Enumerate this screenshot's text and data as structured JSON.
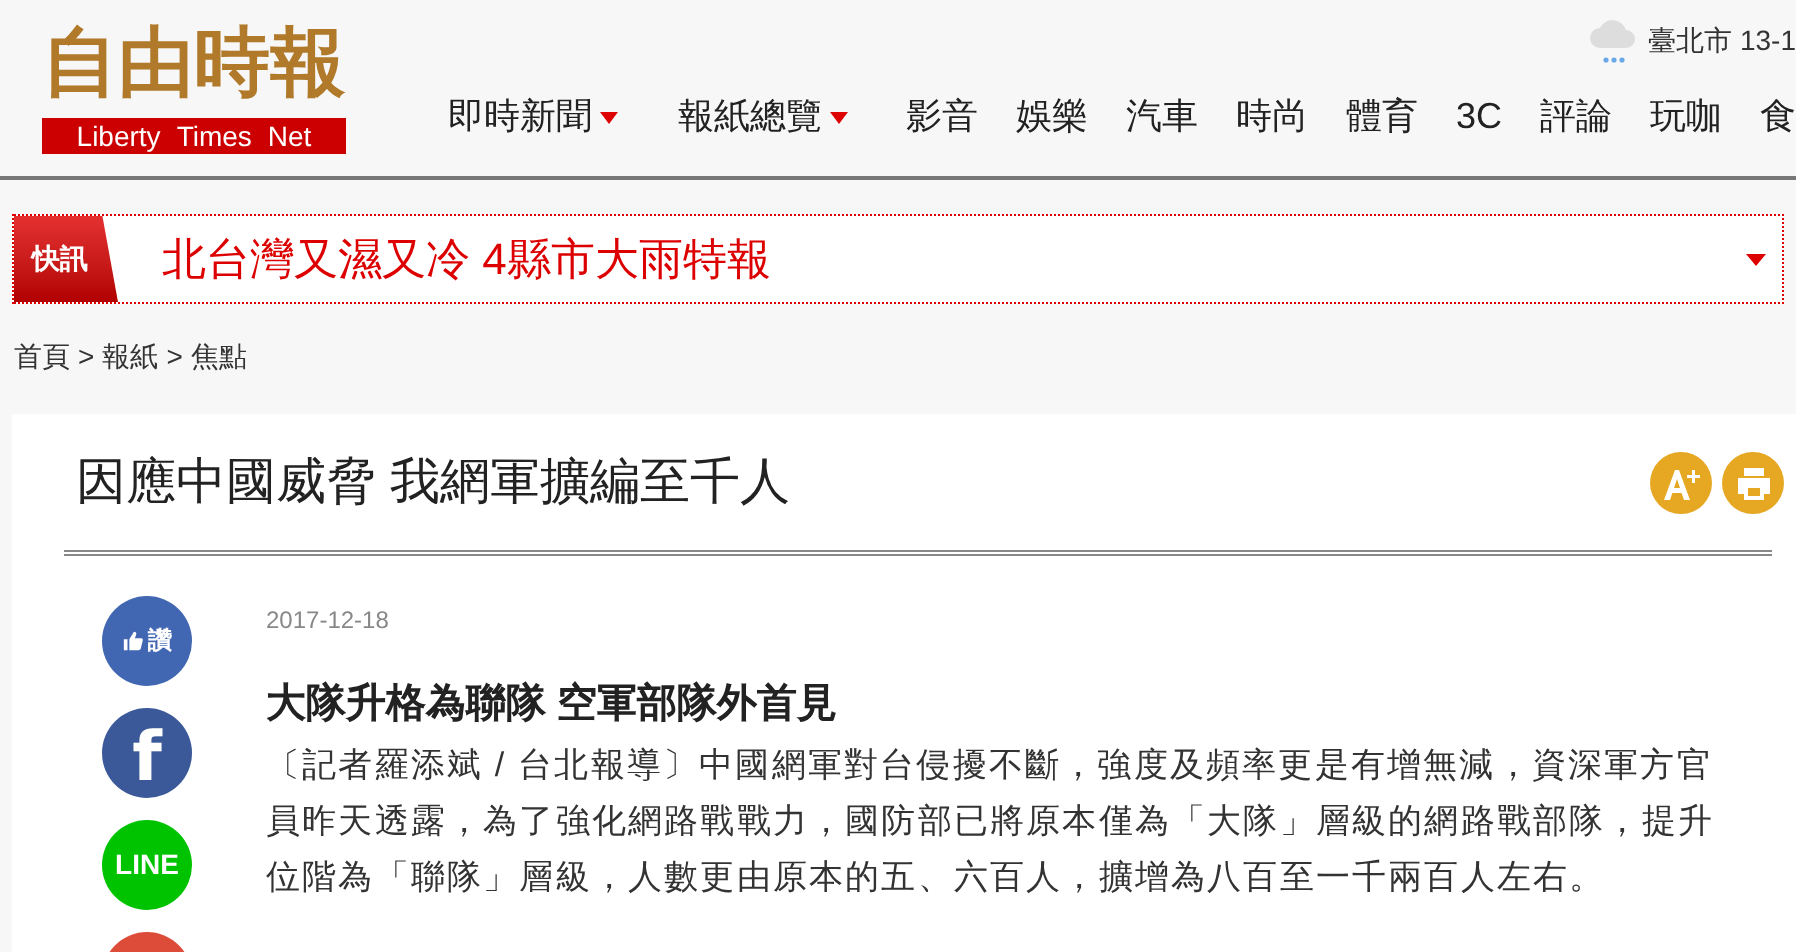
{
  "logo": {
    "chinese": "自由時報",
    "english": [
      "Liberty",
      "Times",
      "Net"
    ]
  },
  "weather": {
    "text": "臺北市 13-1"
  },
  "nav": [
    {
      "label": "即時新聞",
      "has_menu": true
    },
    {
      "label": "報紙總覽",
      "has_menu": true
    },
    {
      "label": "影音",
      "has_menu": false
    },
    {
      "label": "娛樂",
      "has_menu": false
    },
    {
      "label": "汽車",
      "has_menu": false
    },
    {
      "label": "時尚",
      "has_menu": false
    },
    {
      "label": "體育",
      "has_menu": false
    },
    {
      "label": "3C",
      "has_menu": false
    },
    {
      "label": "評論",
      "has_menu": false
    },
    {
      "label": "玩咖",
      "has_menu": false
    },
    {
      "label": "食",
      "has_menu": false
    }
  ],
  "breaking": {
    "tag": "快訊",
    "headline": "北台灣又濕又冷 4縣市大雨特報"
  },
  "breadcrumb": {
    "items": [
      "首頁",
      "報紙",
      "焦點"
    ],
    "separator": ">"
  },
  "article": {
    "title": "因應中國威脅 我網軍擴編至千人",
    "date": "2017-12-18",
    "subtitle": "大隊升格為聯隊 空軍部隊外首見",
    "body": "〔記者羅添斌 / 台北報導〕中國網軍對台侵擾不斷，強度及頻率更是有增無減，資深軍方官員昨天透露，為了強化網路戰戰力，國防部已將原本僅為「大隊」層級的網路戰部隊，提升位階為「聯隊」層級，人數更由原本的五、六百人，擴增為八百至一千兩百人左右。"
  },
  "share_buttons": [
    {
      "kind": "like",
      "label": "讚"
    },
    {
      "kind": "facebook",
      "label": "f"
    },
    {
      "kind": "line",
      "label": "LINE"
    },
    {
      "kind": "other"
    }
  ]
}
